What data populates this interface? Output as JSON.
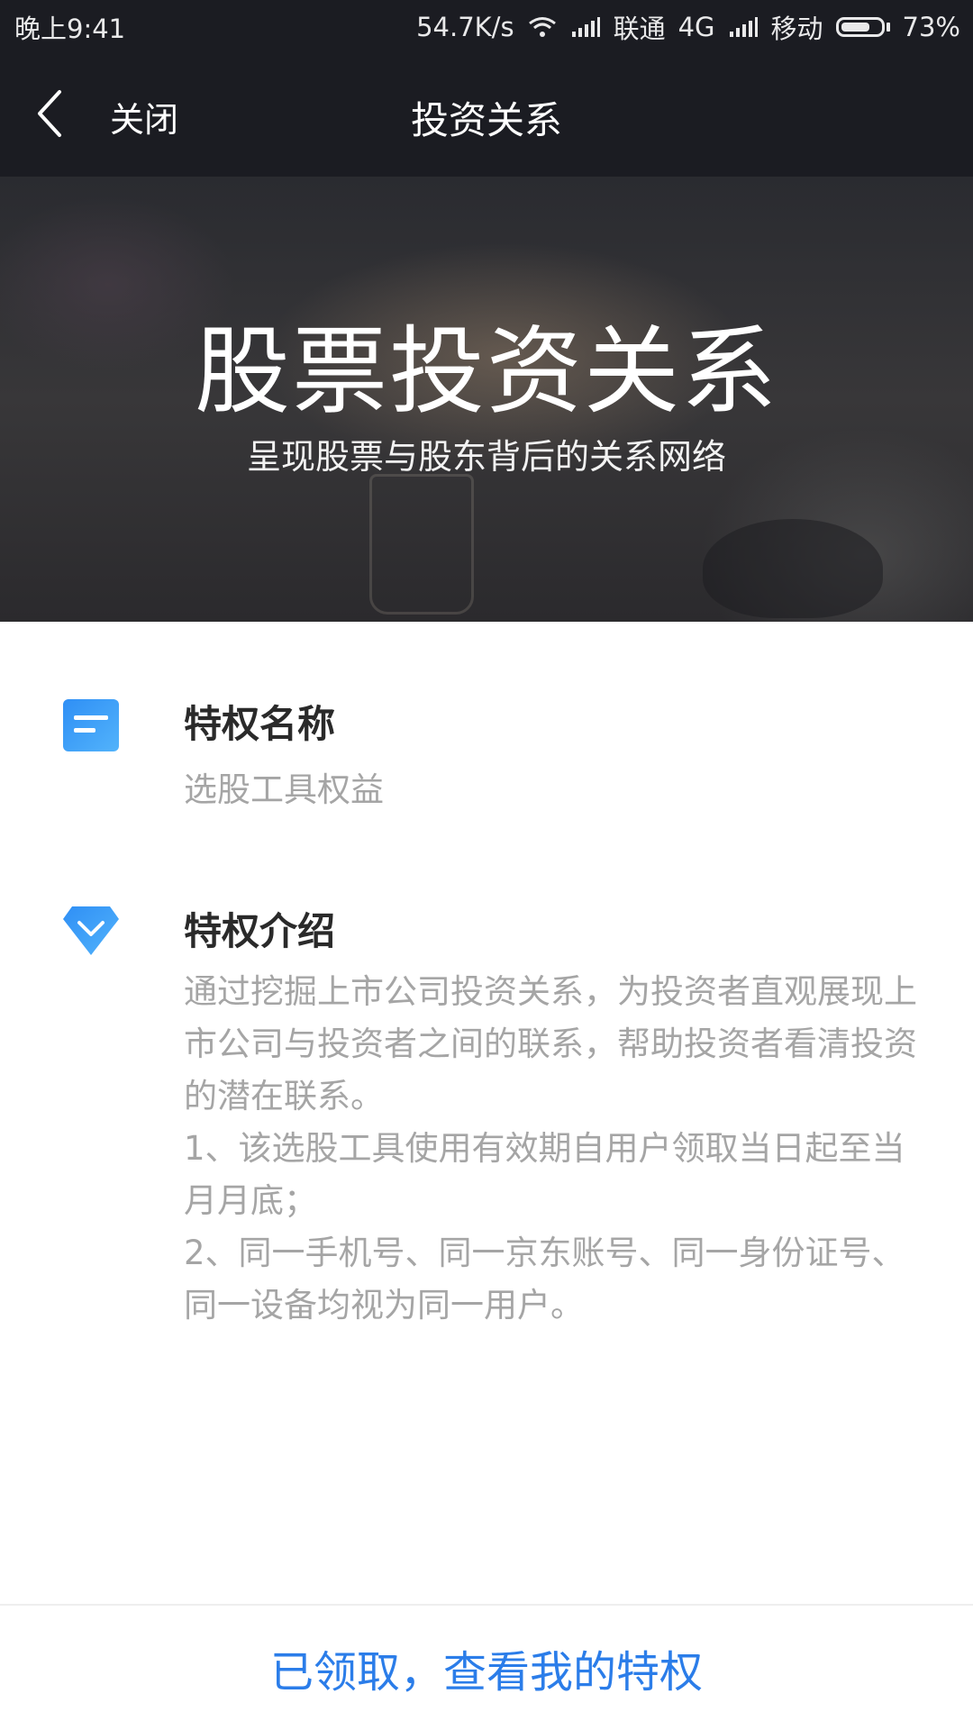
{
  "status_bar": {
    "time": "晚上9:41",
    "speed": "54.7K/s",
    "carrier1": "联通",
    "network": "4G",
    "carrier2": "移动",
    "battery": "73%",
    "battery_level": 0.73
  },
  "nav": {
    "back_icon": "chevron-left-icon",
    "close_label": "关闭",
    "title": "投资关系"
  },
  "hero": {
    "title": "股票投资关系",
    "subtitle": "呈现股票与股东背后的关系网络"
  },
  "privilege_name": {
    "icon": "document-icon",
    "title": "特权名称",
    "value": "选股工具权益"
  },
  "privilege_intro": {
    "icon": "diamond-icon",
    "title": "特权介绍",
    "p1": "通过挖掘上市公司投资关系，为投资者直观展现上市公司与投资者之间的联系，帮助投资者看清投资的潜在联系。",
    "p2": "1、该选股工具使用有效期自用户领取当日起至当月月底；",
    "p3": "2、同一手机号、同一京东账号、同一身份证号、同一设备均视为同一用户。"
  },
  "bottom_button": {
    "label": "已领取，查看我的特权"
  },
  "colors": {
    "accent": "#2b7de9",
    "header_bg": "#1b1c22",
    "icon_blue": "#3e9df5"
  }
}
